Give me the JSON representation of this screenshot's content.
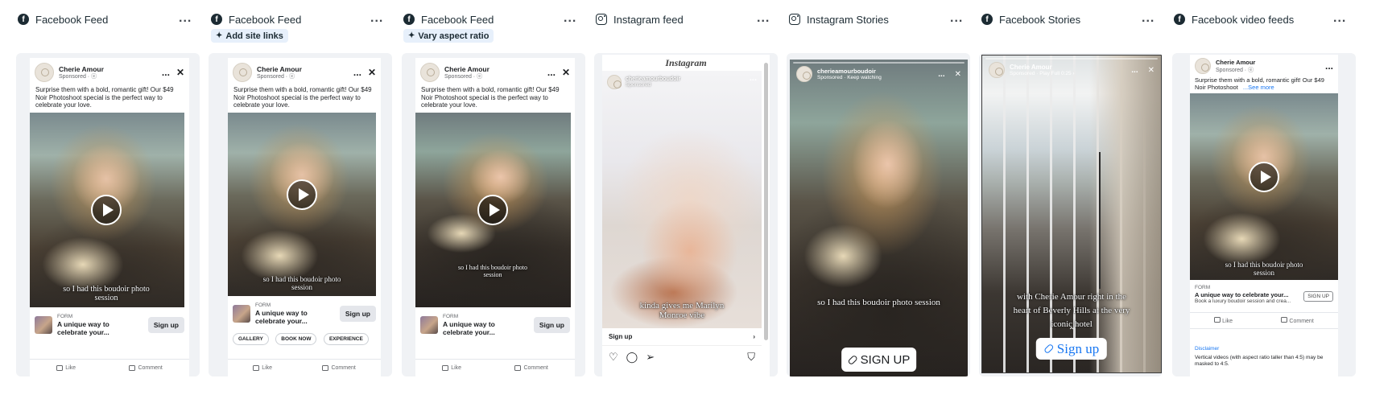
{
  "columns": [
    {
      "platform": "Facebook Feed",
      "icon": "facebook-icon"
    },
    {
      "platform": "Facebook Feed",
      "icon": "facebook-icon",
      "chip": "Add site links"
    },
    {
      "platform": "Facebook Feed",
      "icon": "facebook-icon",
      "chip": "Vary aspect ratio"
    },
    {
      "platform": "Instagram feed",
      "icon": "instagram-icon"
    },
    {
      "platform": "Instagram Stories",
      "icon": "instagram-icon"
    },
    {
      "platform": "Facebook Stories",
      "icon": "facebook-icon"
    },
    {
      "platform": "Facebook video feeds",
      "icon": "facebook-icon"
    }
  ],
  "more_symbol": "...",
  "ad": {
    "brand": "Cherie Amour",
    "sponsored": "Sponsored · ⓔ",
    "caption": "Surprise them with a bold, romantic gift! Our $49 Noir Photoshoot special is the perfect way to celebrate your love.",
    "caption_short": "Surprise them with a bold, romantic gift! Our $49 Noir Photoshoot",
    "see_more": "...See more",
    "form_label": "FORM",
    "headline": "A unique way to celebrate your...",
    "headline_long": "A unique way to celebrate your...",
    "description": "Book a luxury boudoir session and crea...",
    "cta": "Sign up",
    "cta_caps": "SIGN UP",
    "subtitle": "so I had this boudoir photo session",
    "like": "Like",
    "comment": "Comment",
    "site_links": [
      "GALLERY",
      "BOOK NOW",
      "EXPERIENCE"
    ]
  },
  "instagram_feed": {
    "logo": "Instagram",
    "handle": "cherieamourboudoir",
    "sponsored": "Sponsored",
    "subtitle": "kinda gives me Marilyn Monroe vibe",
    "cta": "Sign up"
  },
  "instagram_stories": {
    "handle": "cherieamourboudoir",
    "sub": "Sponsored · Keep watching",
    "subtitle": "so I had this boudoir photo session",
    "cta": "SIGN UP"
  },
  "facebook_stories": {
    "brand": "Cherie Amour",
    "sub": "Sponsored · Play Full 0:25 ›",
    "subtitle": "with Cherie Amour right in the heart of Beverly Hills at the very iconic hotel",
    "cta": "Sign up"
  },
  "video_feeds": {
    "disclaimer_title": "Disclaimer",
    "disclaimer": "Vertical videos (with aspect ratio taller than 4:5) may be masked to 4:5."
  }
}
